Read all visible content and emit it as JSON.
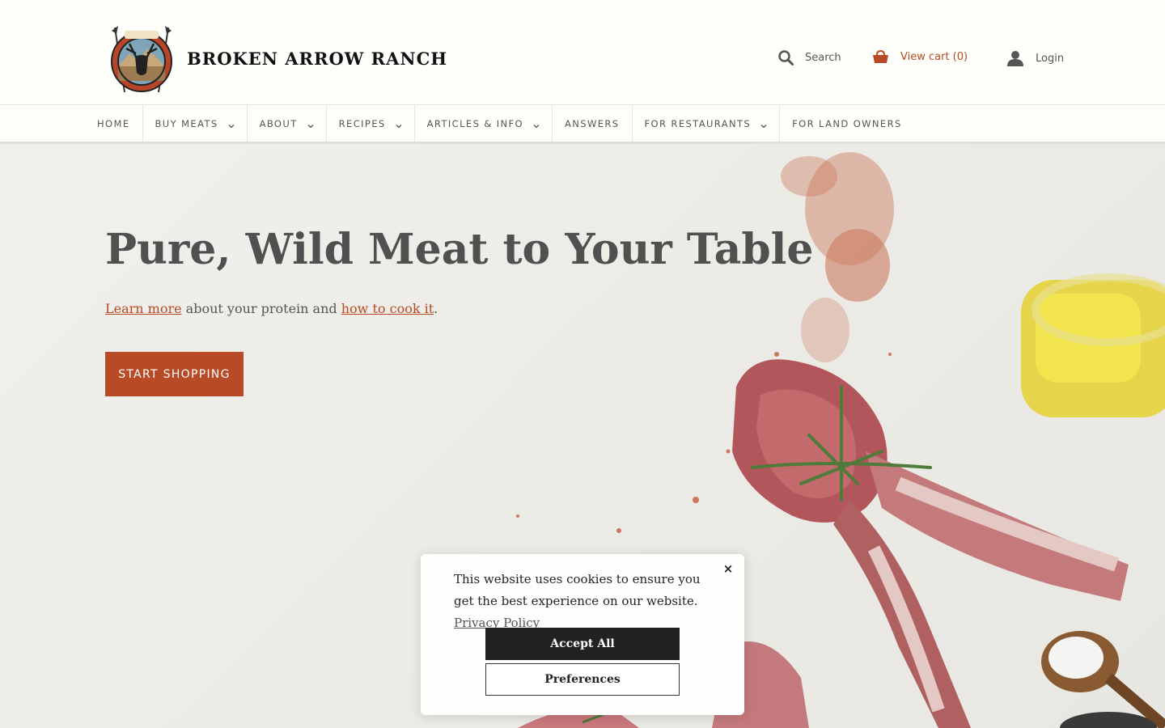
{
  "header": {
    "brand_name": "BROKEN ARROW RANCH",
    "search_label": "Search",
    "cart_label": "View cart (0)",
    "login_label": "Login"
  },
  "nav": {
    "items": [
      {
        "label": "HOME",
        "has_dropdown": false
      },
      {
        "label": "BUY MEATS",
        "has_dropdown": true
      },
      {
        "label": "ABOUT",
        "has_dropdown": true
      },
      {
        "label": "RECIPES",
        "has_dropdown": true
      },
      {
        "label": "ARTICLES & INFO",
        "has_dropdown": true
      },
      {
        "label": "ANSWERS",
        "has_dropdown": false
      },
      {
        "label": "FOR RESTAURANTS",
        "has_dropdown": true
      },
      {
        "label": "FOR LAND OWNERS",
        "has_dropdown": false
      }
    ]
  },
  "hero": {
    "headline": "Pure, Wild Meat to Your Table",
    "sub_link1": "Learn more",
    "sub_text1": " about your protein and ",
    "sub_link2": "how to cook it",
    "sub_text2": ".",
    "cta_label": "START SHOPPING"
  },
  "cookie": {
    "message": "This website uses cookies to ensure you get the best experience on our website. ",
    "policy_link": "Privacy Policy",
    "accept_label": "Accept All",
    "preferences_label": "Preferences",
    "close_icon": "×"
  },
  "colors": {
    "accent": "#b84a25",
    "dark_button": "#222222",
    "background": "#fdfdfa"
  },
  "icons": [
    "logo-emblem-icon",
    "search-icon",
    "cart-icon",
    "user-icon",
    "chevron-down-icon",
    "close-icon"
  ]
}
